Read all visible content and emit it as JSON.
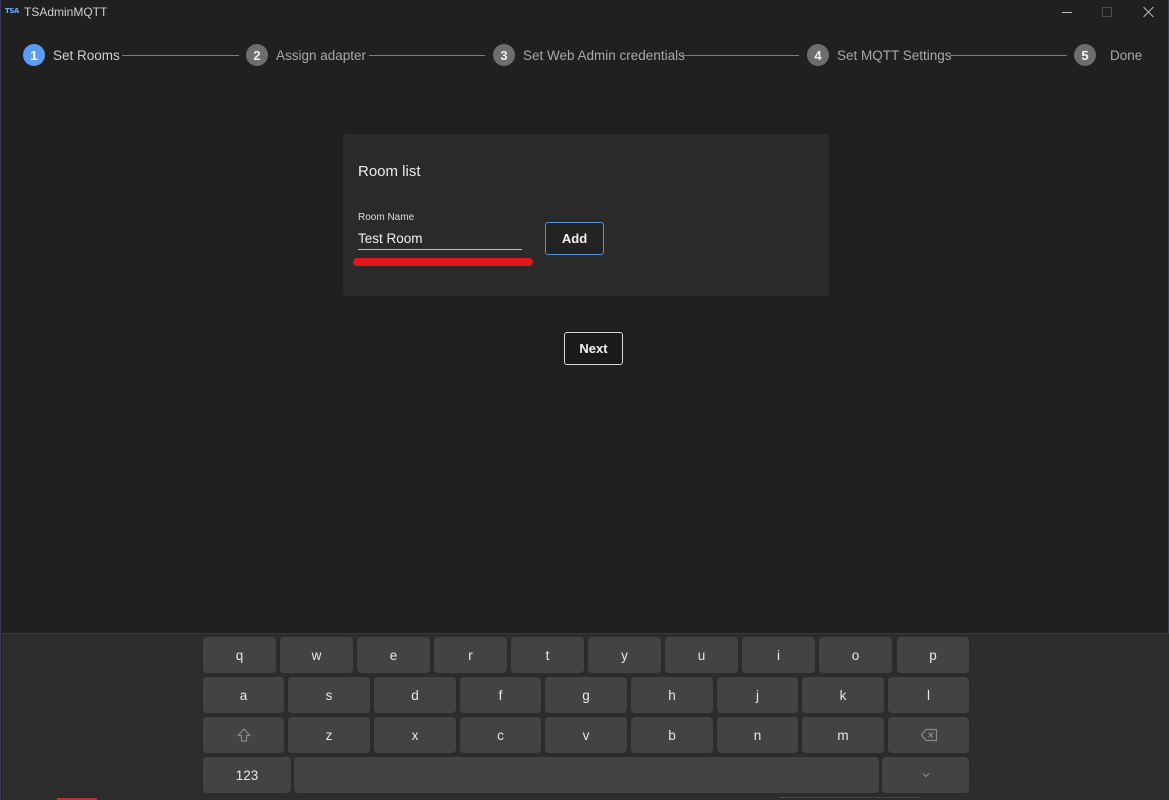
{
  "app": {
    "logo_text": "TSA",
    "title": "TSAdminMQTT"
  },
  "stepper": {
    "steps": [
      {
        "number": "1",
        "label": "Set Rooms",
        "active": true
      },
      {
        "number": "2",
        "label": "Assign adapter",
        "active": false
      },
      {
        "number": "3",
        "label": "Set Web Admin credentials",
        "active": false
      },
      {
        "number": "4",
        "label": "Set MQTT Settings",
        "active": false
      },
      {
        "number": "5",
        "label": "Done",
        "active": false
      }
    ]
  },
  "card": {
    "title": "Room list",
    "field_label": "Room Name",
    "field_value": "Test Room",
    "add_label": "Add"
  },
  "actions": {
    "next_label": "Next"
  },
  "keyboard": {
    "row1": [
      "q",
      "w",
      "e",
      "r",
      "t",
      "y",
      "u",
      "i",
      "o",
      "p"
    ],
    "row2": [
      "a",
      "s",
      "d",
      "f",
      "g",
      "h",
      "j",
      "k",
      "l"
    ],
    "row3": [
      "z",
      "x",
      "c",
      "v",
      "b",
      "n",
      "m"
    ],
    "numbers_label": "123"
  },
  "colors": {
    "accent": "#5b9cf5",
    "highlight": "#e0161b",
    "background": "#202020"
  }
}
